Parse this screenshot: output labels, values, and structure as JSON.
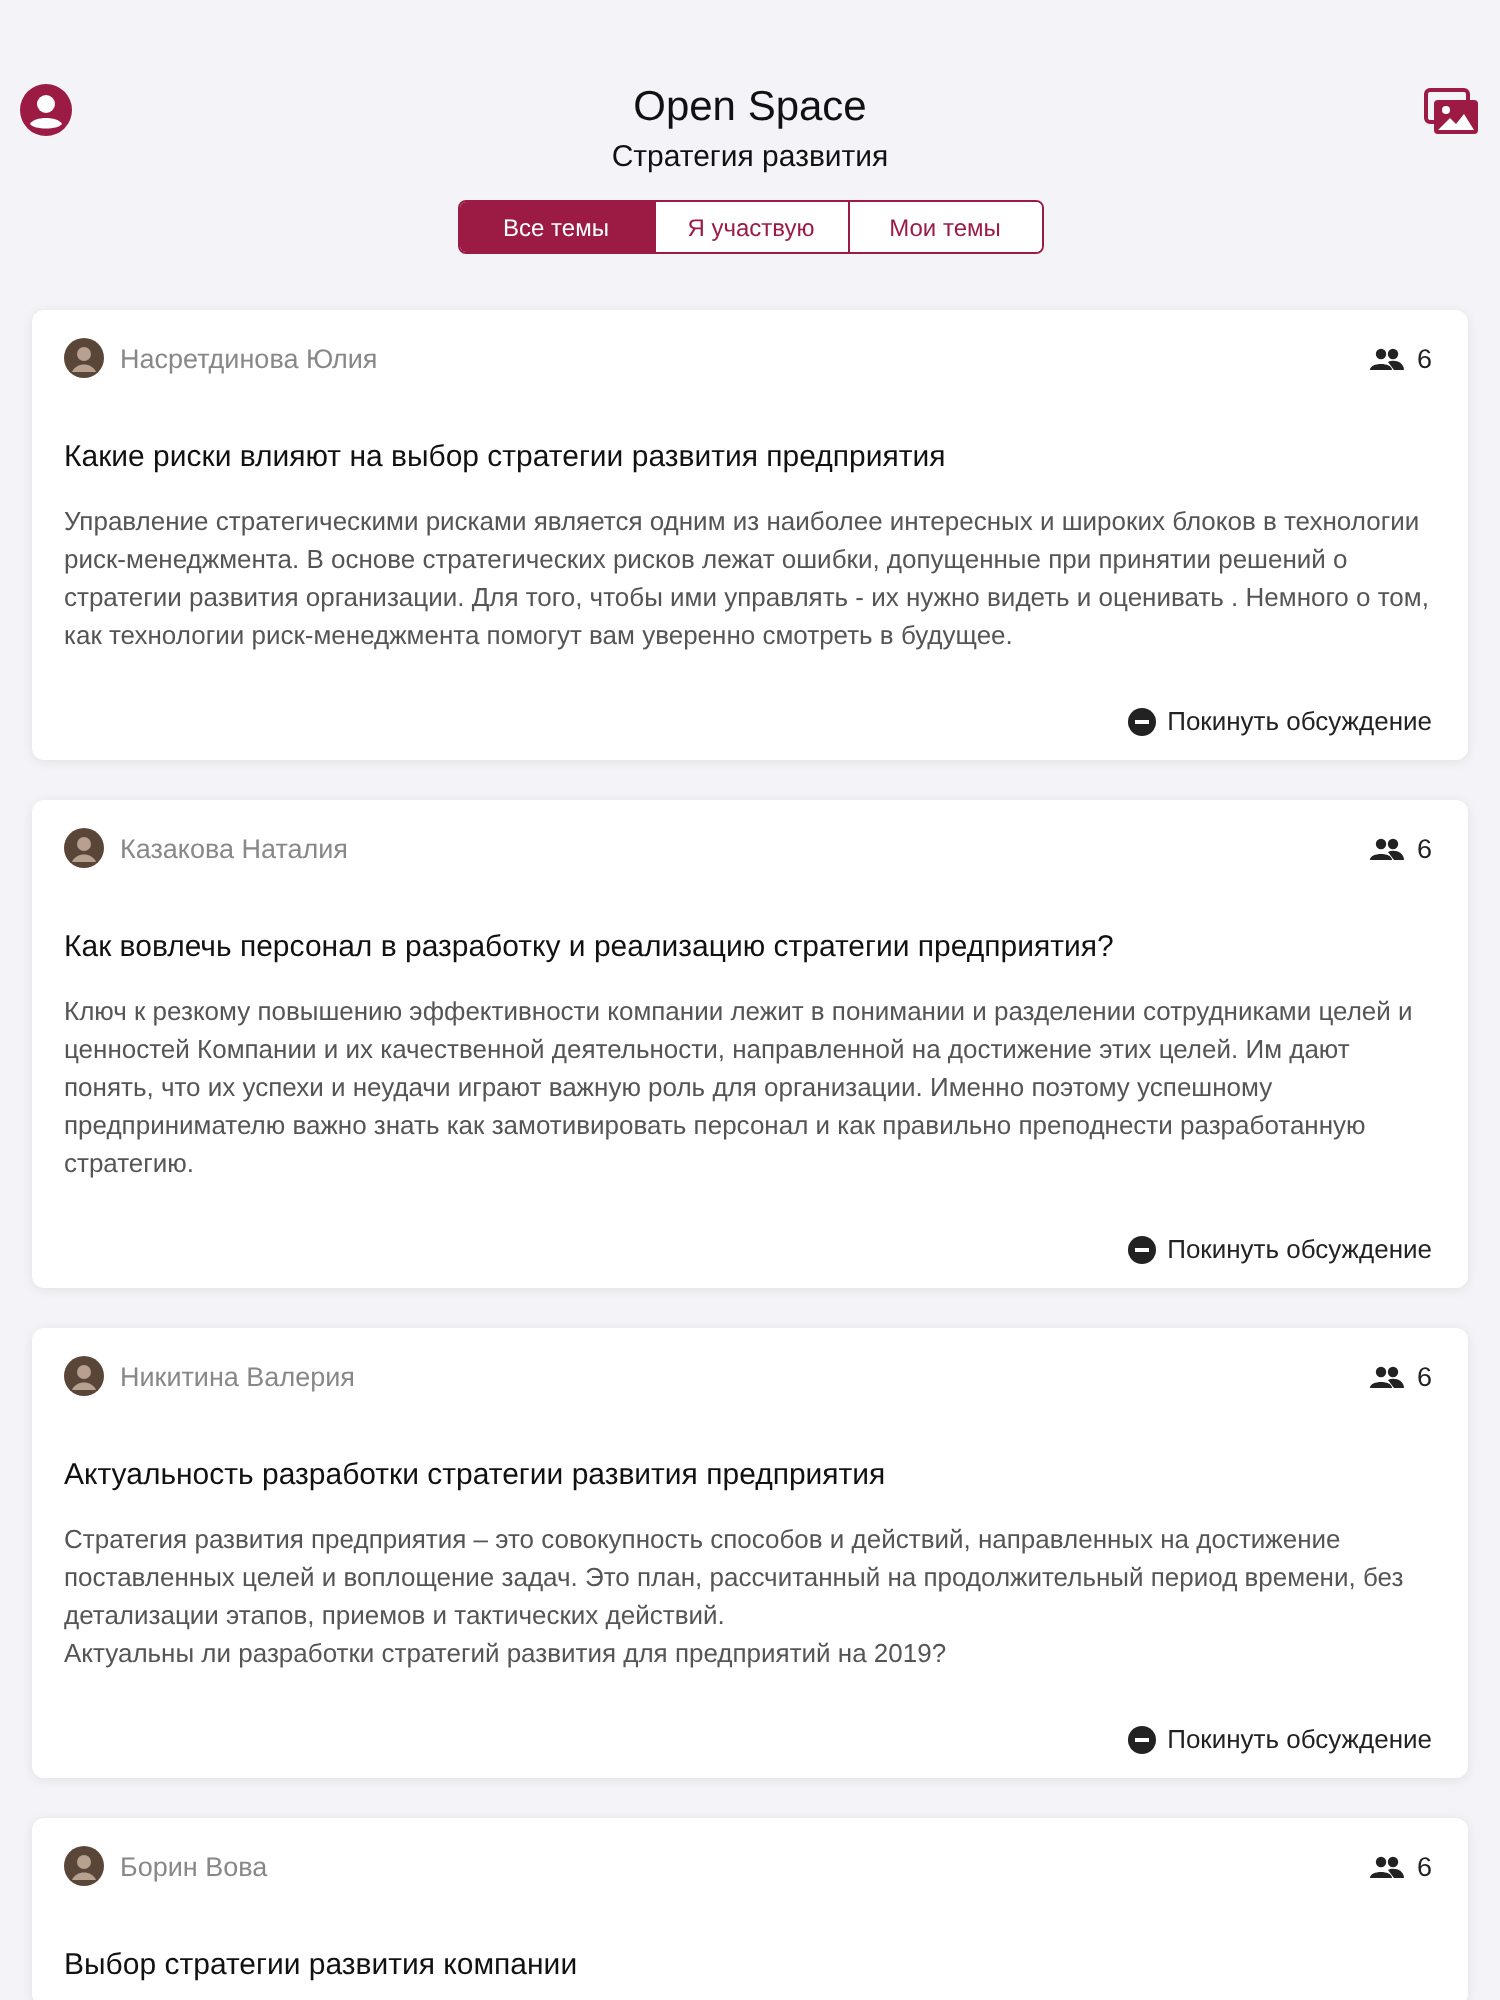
{
  "header": {
    "title": "Open Space",
    "subtitle": "Стратегия развития"
  },
  "tabs": [
    {
      "label": "Все темы",
      "selected": true
    },
    {
      "label": "Я участвую",
      "selected": false
    },
    {
      "label": "Мои темы",
      "selected": false
    }
  ],
  "topics": [
    {
      "author": "Насретдинова Юлия",
      "participants": "6",
      "title": "Какие риски влияют на выбор стратегии развития предприятия",
      "body": [
        "Управление стратегическими рисками является одним из наиболее интересных и широких блоков в технологии риск-менеджмента. В основе стратегических рисков лежат ошибки, допущенные при принятии решений о стратегии развития организации. Для того, чтобы ими управлять - их нужно видеть и оценивать . Немного о том, как технологии риск-менеджмента помогут вам уверенно смотреть в будущее."
      ],
      "action": "Покинуть обсуждение"
    },
    {
      "author": "Казакова Наталия",
      "participants": "6",
      "title": "Как вовлечь персонал в разработку и реализацию стратегии предприятия?",
      "body": [
        "Ключ к резкому повышению эффективности компании лежит в понимании и разделении сотрудниками целей и ценностей Компании и их качественной деятельности, направленной на достижение этих целей. Им дают понять, что их успехи и неудачи играют важную роль для организации. Именно поэтому успешному предпринимателю важно знать как замотивировать персонал и как правильно преподнести разработанную стратегию."
      ],
      "action": "Покинуть обсуждение"
    },
    {
      "author": "Никитина Валерия",
      "participants": "6",
      "title": "Актуальность разработки стратегии развития предприятия",
      "body": [
        "Стратегия развития предприятия – это совокупность способов и действий, направленных на достижение поставленных целей и воплощение задач. Это план, рассчитанный на продолжительный период времени, без детализации этапов, приемов и тактических действий.",
        "Актуальны ли разработки стратегий развития для предприятий на 2019?"
      ],
      "action": "Покинуть обсуждение"
    },
    {
      "author": "Борин Вова",
      "participants": "6",
      "title": "Выбор стратегии развития компании"
    }
  ]
}
